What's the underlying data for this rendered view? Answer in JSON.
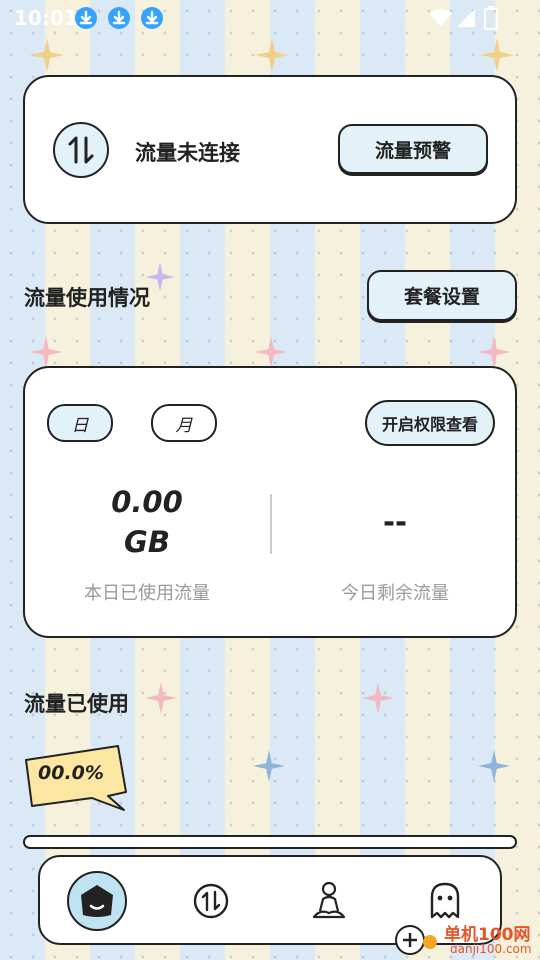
{
  "status_bar": {
    "time": "10:01",
    "download_icons": [
      "download-icon",
      "download-icon",
      "download-icon"
    ],
    "system_icons": [
      "wifi-icon",
      "signal-icon",
      "battery-icon"
    ]
  },
  "connection_card": {
    "icon": "data-transfer-icon",
    "status_text": "流量未连接",
    "alert_button": "流量预警"
  },
  "usage_section": {
    "title": "流量使用情况",
    "plan_button": "套餐设置"
  },
  "usage_card": {
    "tabs": [
      "日",
      "月"
    ],
    "selected_tab": "日",
    "permission_button": "开启权限查看",
    "used_value_line1": "0.00",
    "used_value_line2": "GB",
    "used_label": "本日已使用流量",
    "remaining_value": "--",
    "remaining_label": "今日剩余流量"
  },
  "used_section": {
    "title": "流量已使用",
    "percent_badge": "00.0%",
    "progress_fraction": 0
  },
  "bottom_nav": {
    "items": [
      "home-icon",
      "data-transfer-icon",
      "meditation-icon",
      "ghost-icon"
    ],
    "active": "home-icon"
  },
  "watermark": {
    "brand": "单机100网",
    "url": "danji100.com"
  },
  "colors": {
    "accent_light_blue": "#e3f1f8",
    "download_badge": "#36a2ff",
    "badge_yellow": "#fbe7a1",
    "outline": "#222222"
  }
}
